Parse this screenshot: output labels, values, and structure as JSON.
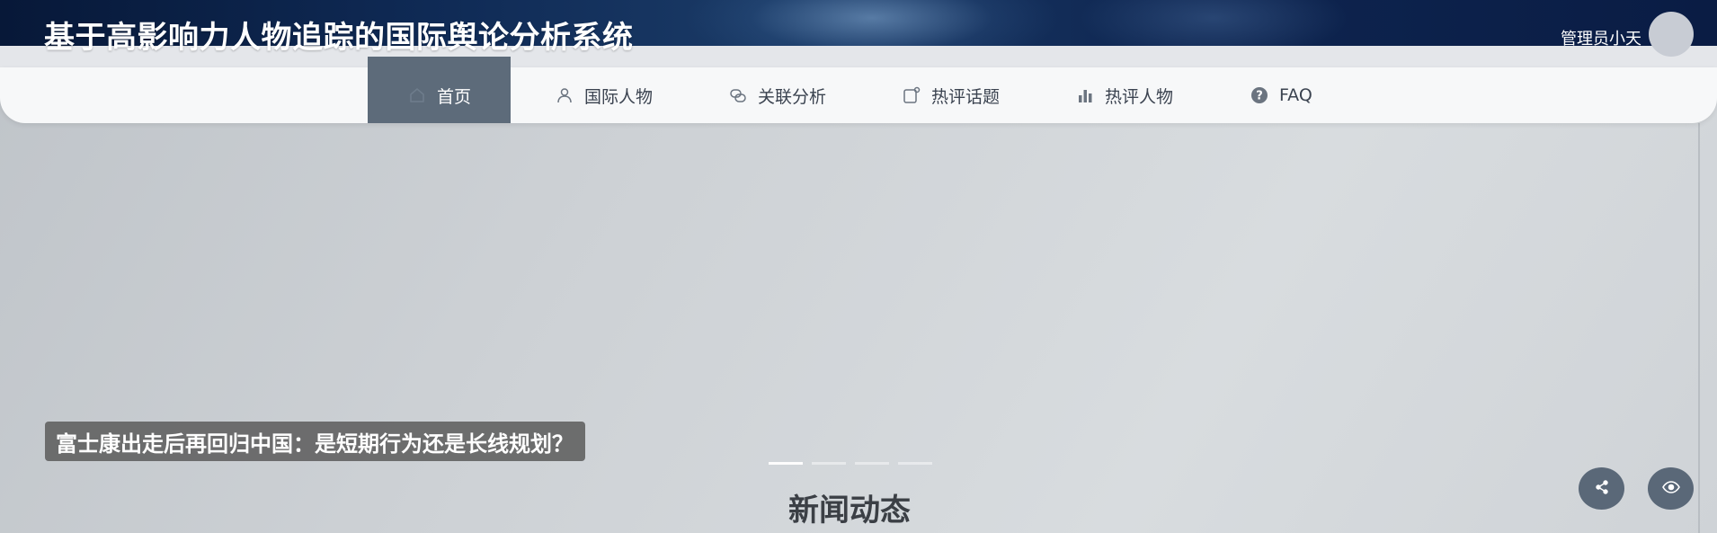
{
  "header": {
    "site_title": "基于高影响力人物追踪的国际舆论分析系统",
    "user_name": "管理员小天"
  },
  "nav": {
    "items": [
      {
        "label": "首页",
        "icon": "home-icon",
        "active": true
      },
      {
        "label": "国际人物",
        "icon": "user-icon"
      },
      {
        "label": "关联分析",
        "icon": "link-icon"
      },
      {
        "label": "热评话题",
        "icon": "topic-icon"
      },
      {
        "label": "热评人物",
        "icon": "bar-chart-icon"
      },
      {
        "label": "FAQ",
        "icon": "help-circle-icon"
      }
    ]
  },
  "carousel": {
    "caption": "富士康出走后再回归中国：是短期行为还是长线规划？",
    "slide_count": 4,
    "active_index": 0
  },
  "section": {
    "title": "新闻动态"
  },
  "floating": {
    "share_icon": "share-icon",
    "view_icon": "eye-icon"
  },
  "colors": {
    "active_nav": "#5d6b7a",
    "header_dark": "#0f2a55",
    "fab": "#5a6878"
  }
}
